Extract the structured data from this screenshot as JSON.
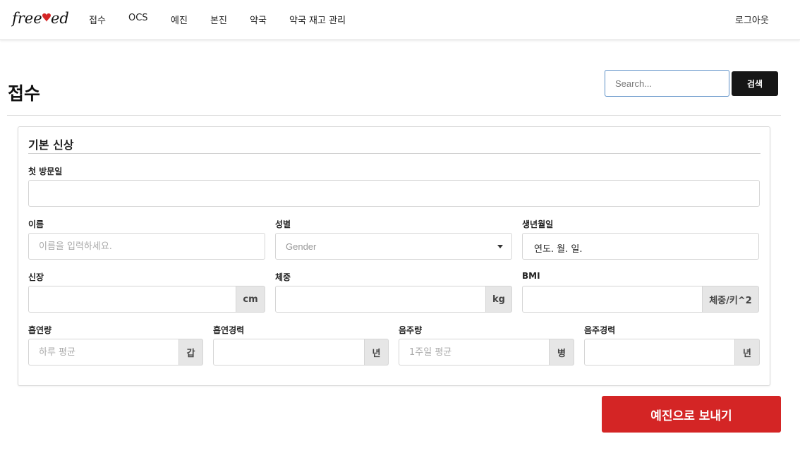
{
  "nav": {
    "logo_text": "freeMed",
    "items": [
      "접수",
      "OCS",
      "예진",
      "본진",
      "약국",
      "약국 재고 관리"
    ],
    "logout": "로그아웃"
  },
  "page": {
    "title": "접수",
    "search_placeholder": "Search...",
    "search_button": "검색"
  },
  "form": {
    "section_title": "기본 신상",
    "first_visit": {
      "label": "첫 방문일",
      "value": ""
    },
    "name": {
      "label": "이름",
      "placeholder": "이름을 입력하세요."
    },
    "gender": {
      "label": "성별",
      "selected": "Gender"
    },
    "birth": {
      "label": "생년월일",
      "value": "연도. 월. 일."
    },
    "height": {
      "label": "신장",
      "unit": "cm"
    },
    "weight": {
      "label": "체중",
      "unit": "kg"
    },
    "bmi": {
      "label": "BMI",
      "unit": "체중/키^2"
    },
    "smoking_amount": {
      "label": "흡연량",
      "placeholder": "하루 평균",
      "unit": "갑"
    },
    "smoking_years": {
      "label": "흡연경력",
      "unit": "년"
    },
    "drinking_amount": {
      "label": "음주량",
      "placeholder": "1주일 평균",
      "unit": "병"
    },
    "drinking_years": {
      "label": "음주경력",
      "unit": "년"
    }
  },
  "submit_button": "예진으로 보내기",
  "colors": {
    "accent": "#d42525",
    "dark_button": "#161616",
    "input_focus": "#5b8fc6"
  }
}
